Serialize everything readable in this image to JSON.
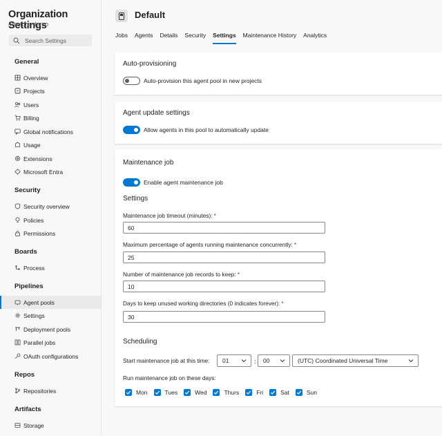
{
  "sidebar": {
    "title": "Organization Settings",
    "subtitle": "4tecture-demo",
    "search_placeholder": "Search Settings",
    "groups": {
      "general": {
        "heading": "General",
        "items": [
          "Overview",
          "Projects",
          "Users",
          "Billing",
          "Global notifications",
          "Usage",
          "Extensions",
          "Microsoft Entra"
        ]
      },
      "security": {
        "heading": "Security",
        "items": [
          "Security overview",
          "Policies",
          "Permissions"
        ]
      },
      "boards": {
        "heading": "Boards",
        "items": [
          "Process"
        ]
      },
      "pipelines": {
        "heading": "Pipelines",
        "items": [
          "Agent pools",
          "Settings",
          "Deployment pools",
          "Parallel jobs",
          "OAuth configurations"
        ],
        "selected": "Agent pools"
      },
      "repos": {
        "heading": "Repos",
        "items": [
          "Repositories"
        ]
      },
      "artifacts": {
        "heading": "Artifacts",
        "items": [
          "Storage"
        ]
      }
    }
  },
  "header": {
    "title": "Default",
    "tabs": [
      "Jobs",
      "Agents",
      "Details",
      "Security",
      "Settings",
      "Maintenance History",
      "Analytics"
    ],
    "active_tab": "Settings"
  },
  "auto_provisioning": {
    "title": "Auto-provisioning",
    "toggle_label": "Auto-provision this agent pool in new projects",
    "enabled": false
  },
  "agent_update": {
    "title": "Agent update settings",
    "toggle_label": "Allow agents in this pool to automatically update",
    "enabled": true
  },
  "maintenance": {
    "title": "Maintenance job",
    "toggle_label": "Enable agent maintenance job",
    "enabled": true,
    "settings_heading": "Settings",
    "fields": [
      {
        "label": "Maintenance job timeout (minutes):",
        "required": "*",
        "value": "60"
      },
      {
        "label": "Maximum percentage of agents running maintenance concurrently:",
        "required": "*",
        "value": "25"
      },
      {
        "label": "Number of maintenance job records to keep:",
        "required": "*",
        "value": "10"
      },
      {
        "label": "Days to keep unused working directories (0 indicates forever):",
        "required": "*",
        "value": "30"
      }
    ],
    "scheduling": {
      "heading": "Scheduling",
      "start_label": "Start maintenance job at this time:",
      "hour": "01",
      "separator": ":",
      "minute": "00",
      "timezone": "(UTC) Coordinated Universal Time",
      "days_label": "Run maintenance job on these days:",
      "days": [
        "Mon",
        "Tues",
        "Wed",
        "Thurs",
        "Fri",
        "Sat",
        "Sun"
      ]
    }
  },
  "colors": {
    "accent": "#0078d4",
    "required": "#a4262c"
  }
}
